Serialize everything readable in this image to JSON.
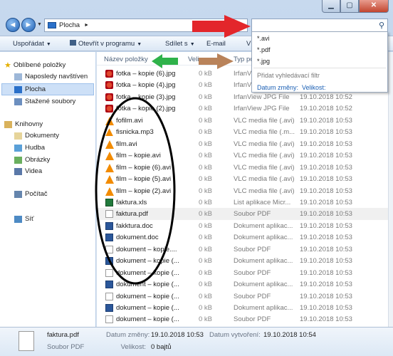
{
  "window": {
    "controls": [
      "▁",
      "▢",
      "✕"
    ]
  },
  "address": {
    "back": "◄",
    "forward": "►",
    "dropdown": "▼",
    "location": "Plocha",
    "separator": "►",
    "search_icon": "⚲"
  },
  "search_dropdown": {
    "items": [
      "*.avi",
      "*.pdf",
      "*.jpg"
    ],
    "hint": "Přidat vyhledávací filtr",
    "filters": [
      "Datum změny:",
      "Velikost:"
    ]
  },
  "toolbar": {
    "organize": "Uspořádat",
    "open_with": "Otevřít v programu",
    "share": "Sdílet s",
    "email": "E-mail",
    "trailing": "V"
  },
  "nav": {
    "favorites": "Oblíbené položky",
    "recent": "Naposledy navštíven",
    "desktop": "Plocha",
    "downloads": "Stažené soubory",
    "libraries": "Knihovny",
    "documents": "Dokumenty",
    "music": "Hudba",
    "pictures": "Obrázky",
    "videos": "Videa",
    "computer": "Počítač",
    "network": "Síť"
  },
  "columns": {
    "name": "Název položky",
    "size": "Veli",
    "type": "Typ po"
  },
  "files": [
    {
      "name": "fotka – kopie (6).jpg",
      "size": "0 kB",
      "type": "IrfanVi",
      "date": "",
      "icon": "jpg"
    },
    {
      "name": "fotka – kopie (4).jpg",
      "size": "0 kB",
      "type": "IrfanVi",
      "date": "",
      "icon": "jpg"
    },
    {
      "name": "fotka – kopie (3).jpg",
      "size": "0 kB",
      "type": "IrfanView JPG File",
      "date": "19.10.2018 10:52",
      "icon": "jpg"
    },
    {
      "name": "fotka – kopie (2).jpg",
      "size": "0 kB",
      "type": "IrfanView JPG File",
      "date": "19.10.2018 10:52",
      "icon": "jpg"
    },
    {
      "name": "fofilm.avi",
      "size": "0 kB",
      "type": "VLC media file (.avi)",
      "date": "19.10.2018 10:53",
      "icon": "vlc"
    },
    {
      "name": "fisnicka.mp3",
      "size": "0 kB",
      "type": "VLC media file (.m...",
      "date": "19.10.2018 10:53",
      "icon": "mp3"
    },
    {
      "name": "film.avi",
      "size": "0 kB",
      "type": "VLC media file (.avi)",
      "date": "19.10.2018 10:53",
      "icon": "vlc"
    },
    {
      "name": "film – kopie.avi",
      "size": "0 kB",
      "type": "VLC media file (.avi)",
      "date": "19.10.2018 10:53",
      "icon": "vlc"
    },
    {
      "name": "film – kopie (6).avi",
      "size": "0 kB",
      "type": "VLC media file (.avi)",
      "date": "19.10.2018 10:53",
      "icon": "vlc"
    },
    {
      "name": "film – kopie (5).avi",
      "size": "0 kB",
      "type": "VLC media file (.avi)",
      "date": "19.10.2018 10:53",
      "icon": "vlc"
    },
    {
      "name": "film – kopie (2).avi",
      "size": "0 kB",
      "type": "VLC media file (.avi)",
      "date": "19.10.2018 10:53",
      "icon": "vlc"
    },
    {
      "name": "faktura.xls",
      "size": "0 kB",
      "type": "List aplikace Micr...",
      "date": "19.10.2018 10:53",
      "icon": "xls"
    },
    {
      "name": "faktura.pdf",
      "size": "0 kB",
      "type": "Soubor PDF",
      "date": "19.10.2018 10:53",
      "icon": "pdf",
      "highlight": true
    },
    {
      "name": "fakktura.doc",
      "size": "0 kB",
      "type": "Dokument aplikac...",
      "date": "19.10.2018 10:53",
      "icon": "doc"
    },
    {
      "name": "dokument.doc",
      "size": "0 kB",
      "type": "Dokument aplikac...",
      "date": "19.10.2018 10:53",
      "icon": "doc"
    },
    {
      "name": "dokument – kopie....",
      "size": "0 kB",
      "type": "Soubor PDF",
      "date": "19.10.2018 10:53",
      "icon": "pdf"
    },
    {
      "name": "dokument – kopie (...",
      "size": "0 kB",
      "type": "Dokument aplikac...",
      "date": "19.10.2018 10:53",
      "icon": "doc"
    },
    {
      "name": "dokument – kopie (...",
      "size": "0 kB",
      "type": "Soubor PDF",
      "date": "19.10.2018 10:53",
      "icon": "pdf"
    },
    {
      "name": "dokument – kopie (...",
      "size": "0 kB",
      "type": "Dokument aplikac...",
      "date": "19.10.2018 10:53",
      "icon": "doc"
    },
    {
      "name": "dokument – kopie (...",
      "size": "0 kB",
      "type": "Soubor PDF",
      "date": "19.10.2018 10:53",
      "icon": "pdf"
    },
    {
      "name": "dokument – kopie (...",
      "size": "0 kB",
      "type": "Dokument aplikac...",
      "date": "19.10.2018 10:53",
      "icon": "doc"
    },
    {
      "name": "dokument – kopie (...",
      "size": "0 kB",
      "type": "Soubor PDF",
      "date": "19.10.2018 10:53",
      "icon": "pdf"
    }
  ],
  "status": {
    "filename": "faktura.pdf",
    "filetype": "Soubor PDF",
    "modified_label": "Datum změny:",
    "modified_value": "19.10.2018 10:53",
    "size_label": "Velikost:",
    "size_value": "0 bajtů",
    "created_label": "Datum vytvoření:",
    "created_value": "19.10.2018 10:54"
  },
  "annotation_colors": {
    "red_arrow": "#e3262b",
    "green_arrow": "#2fb24a",
    "brown_arrow": "#b9835a",
    "ellipse": "#000000"
  }
}
